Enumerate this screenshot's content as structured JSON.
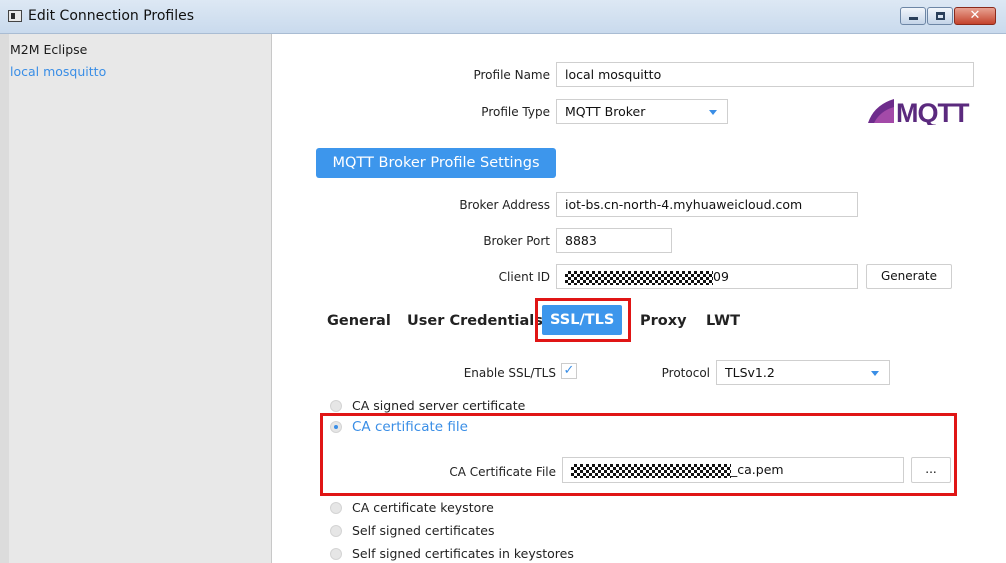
{
  "window": {
    "title": "Edit Connection Profiles"
  },
  "sidebar": {
    "items": [
      {
        "label": "M2M Eclipse"
      },
      {
        "label": "local mosquitto"
      }
    ]
  },
  "profile": {
    "name_label": "Profile Name",
    "name_value": "local mosquitto",
    "type_label": "Profile Type",
    "type_value": "MQTT Broker",
    "logo_text": "MQTT"
  },
  "settings": {
    "section_title": "MQTT Broker Profile Settings",
    "broker_address_label": "Broker Address",
    "broker_address_value": "iot-bs.cn-north-4.myhuaweicloud.com",
    "broker_port_label": "Broker Port",
    "broker_port_value": "8883",
    "client_id_label": "Client ID",
    "client_id_suffix": "09",
    "generate_label": "Generate"
  },
  "tabs": [
    {
      "label": "General"
    },
    {
      "label": "User Credentials"
    },
    {
      "label": "SSL/TLS",
      "active": true
    },
    {
      "label": "Proxy"
    },
    {
      "label": "LWT"
    }
  ],
  "ssl": {
    "enable_label": "Enable SSL/TLS",
    "enable_checked": true,
    "protocol_label": "Protocol",
    "protocol_value": "TLSv1.2",
    "options": [
      {
        "label": "CA signed server certificate",
        "selected": false
      },
      {
        "label": "CA certificate file",
        "selected": true
      },
      {
        "label": "CA certificate keystore",
        "selected": false
      },
      {
        "label": "Self signed certificates",
        "selected": false
      },
      {
        "label": "Self signed certificates in keystores",
        "selected": false
      }
    ],
    "ca_file_label": "CA Certificate File",
    "ca_file_suffix": "_ca.pem",
    "browse_label": "..."
  },
  "colors": {
    "accent": "#3d96ec",
    "highlight": "#e01515"
  }
}
